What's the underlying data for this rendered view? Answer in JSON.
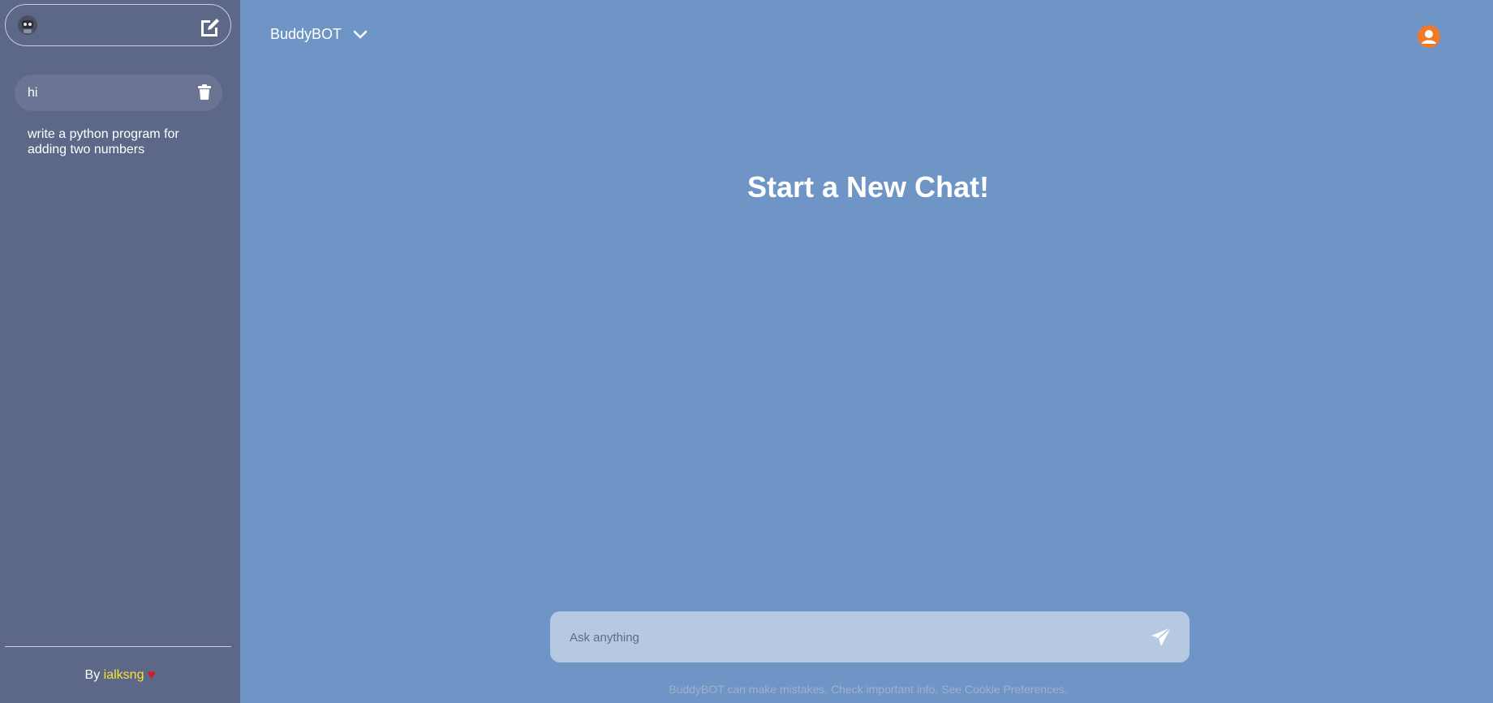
{
  "sidebar": {
    "logo_icon": "robot-avatar-icon",
    "new_chat_icon": "edit-square-icon",
    "chats": [
      {
        "label": "hi",
        "active": true,
        "delete_icon": "trash-icon"
      },
      {
        "label": "write a python program for adding two numbers",
        "active": false
      }
    ],
    "footer": {
      "prefix": "By",
      "name": "ialksng",
      "heart": "♥"
    }
  },
  "header": {
    "model_name": "BuddyBOT",
    "dropdown_icon": "chevron-down-icon",
    "user_icon": "user-circle-icon"
  },
  "main": {
    "headline": "Start a New Chat!",
    "input_placeholder": "Ask anything",
    "send_icon": "paper-plane-icon",
    "disclaimer": "BuddyBOT can make mistakes. Check important info. See Cookie Preferences."
  },
  "colors": {
    "sidebar_bg": "#5d6787",
    "main_bg": "#6f95c6",
    "accent_user": "#f07a28",
    "credit_name": "#f5e53a",
    "heart": "#e8121a"
  }
}
